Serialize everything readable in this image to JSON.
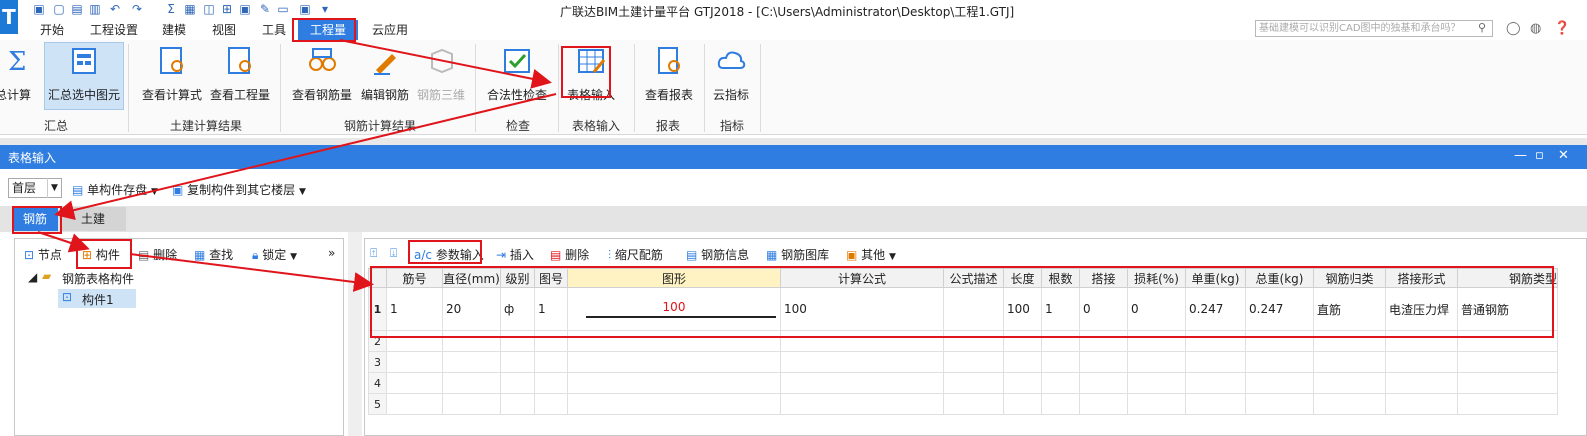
{
  "window": {
    "title": "广联达BIM土建计量平台 GTJ2018 - [C:\\Users\\Administrator\\Desktop\\工程1.GTJ]",
    "search_placeholder": "基础建模可以识别CAD图中的独基和承台吗？"
  },
  "menu": {
    "tabs": [
      "开始",
      "工程设置",
      "建模",
      "视图",
      "工具",
      "工程量",
      "云应用"
    ],
    "active": "工程量"
  },
  "ribbon": {
    "buttons": [
      {
        "label": "汇总计算"
      },
      {
        "label": "汇总选中图元"
      },
      {
        "label": "查看计算式"
      },
      {
        "label": "查看工程量"
      },
      {
        "label": "查看钢筋量"
      },
      {
        "label": "编辑钢筋"
      },
      {
        "label": "钢筋三维"
      },
      {
        "label": "合法性检查"
      },
      {
        "label": "表格输入"
      },
      {
        "label": "查看报表"
      },
      {
        "label": "云指标"
      }
    ],
    "groups": [
      "汇总",
      "土建计算结果",
      "钢筋计算结果",
      "检查",
      "表格输入",
      "报表",
      "指标"
    ]
  },
  "panel": {
    "title": "表格输入",
    "floor": "首层",
    "save_mode": "单构件存盘",
    "copy_label": "复制构件到其它楼层",
    "tabs": [
      "钢筋",
      "土建"
    ]
  },
  "left": {
    "toolbar": [
      "节点",
      "构件",
      "删除",
      "查找",
      "锁定"
    ],
    "tree_root": "钢筋表格构件",
    "tree_child": "构件1"
  },
  "right": {
    "toolbar": [
      "参数输入",
      "插入",
      "删除",
      "缩尺配筋",
      "钢筋信息",
      "钢筋图库",
      "其他"
    ]
  },
  "grid": {
    "headers": [
      "筋号",
      "直径(mm)",
      "级别",
      "图号",
      "图形",
      "计算公式",
      "公式描述",
      "长度",
      "根数",
      "搭接",
      "损耗(%)",
      "单重(kg)",
      "总重(kg)",
      "钢筋归类",
      "搭接形式",
      "钢筋类型"
    ],
    "rows": [
      {
        "n": "1",
        "cells": [
          "1",
          "20",
          "ф",
          "1",
          "100",
          "100",
          "",
          "100",
          "1",
          "0",
          "0",
          "0.247",
          "0.247",
          "直筋",
          "电渣压力焊",
          "普通钢筋"
        ]
      },
      {
        "n": "2",
        "cells": [
          "",
          "",
          "",
          "",
          "",
          "",
          "",
          "",
          "",
          "",
          "",
          "",
          "",
          "",
          "",
          ""
        ]
      },
      {
        "n": "3",
        "cells": [
          "",
          "",
          "",
          "",
          "",
          "",
          "",
          "",
          "",
          "",
          "",
          "",
          "",
          "",
          "",
          ""
        ]
      },
      {
        "n": "4",
        "cells": [
          "",
          "",
          "",
          "",
          "",
          "",
          "",
          "",
          "",
          "",
          "",
          "",
          "",
          "",
          "",
          ""
        ]
      },
      {
        "n": "5",
        "cells": [
          "",
          "",
          "",
          "",
          "",
          "",
          "",
          "",
          "",
          "",
          "",
          "",
          "",
          "",
          "",
          ""
        ]
      }
    ]
  },
  "colors": {
    "accent": "#2f7de0",
    "annotation": "#e0141b",
    "shape_text": "#e0141b"
  }
}
